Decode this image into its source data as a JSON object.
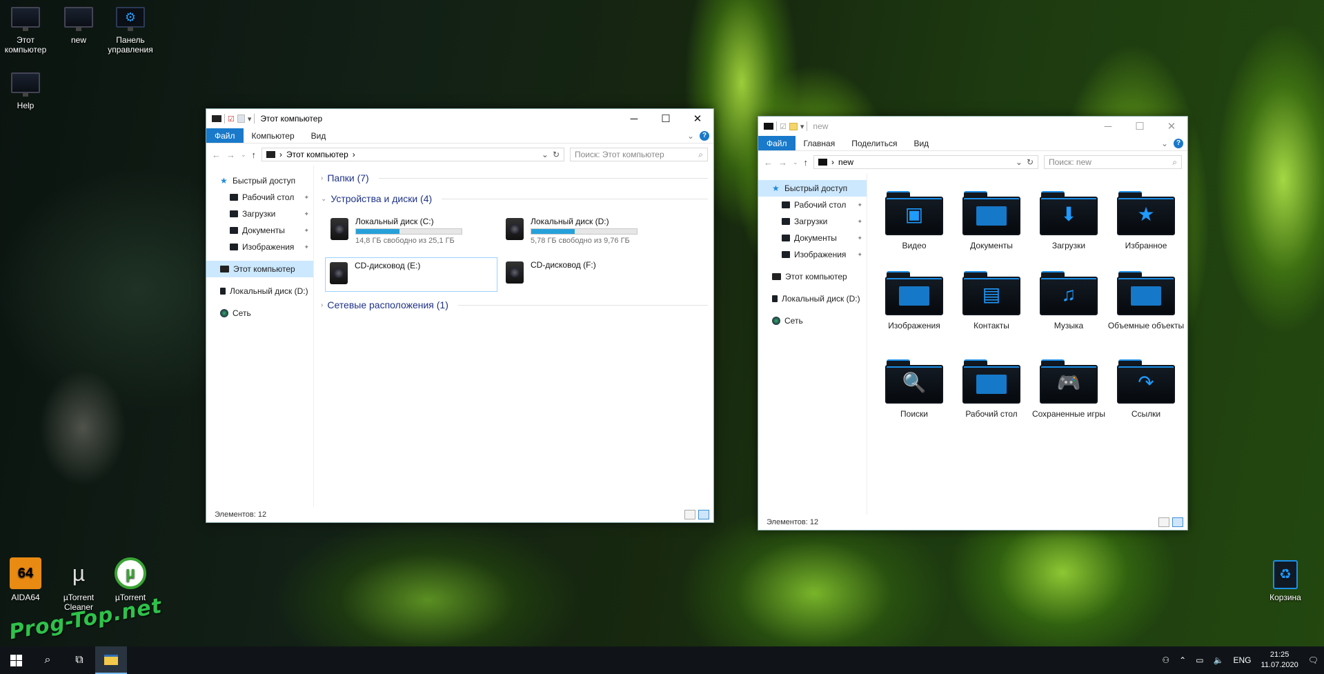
{
  "desktop": {
    "icons_top": [
      {
        "label": "Этот компьютер",
        "icon": "monitor-icon"
      },
      {
        "label": "new",
        "icon": "monitor-icon"
      },
      {
        "label": "Панель управления",
        "icon": "control-panel-icon"
      },
      {
        "label": "Help",
        "icon": "monitor-icon"
      }
    ],
    "icons_bottom": [
      {
        "label": "AIDA64",
        "icon": "aida64-icon"
      },
      {
        "label": "µTorrent Cleaner",
        "icon": "utorrent-cleaner-icon"
      },
      {
        "label": "µTorrent",
        "icon": "utorrent-icon"
      }
    ],
    "recycle_bin": "Корзина",
    "watermark": "Prog-Top.net"
  },
  "win1": {
    "title": "Этот компьютер",
    "tabs": {
      "file": "Файл",
      "computer": "Компьютер",
      "view": "Вид"
    },
    "address": "Этот компьютер",
    "search_placeholder": "Поиск: Этот компьютер",
    "nav": {
      "quick": "Быстрый доступ",
      "desktop": "Рабочий стол",
      "downloads": "Загрузки",
      "documents": "Документы",
      "images": "Изображения",
      "this_pc": "Этот компьютер",
      "local_d": "Локальный диск (D:)",
      "network": "Сеть"
    },
    "groups": {
      "folders": "Папки (7)",
      "devices": "Устройства и диски (4)",
      "network": "Сетевые расположения (1)"
    },
    "drives": [
      {
        "name": "Локальный диск (C:)",
        "free": "14,8 ГБ свободно из 25,1 ГБ",
        "used_fraction": 0.41
      },
      {
        "name": "Локальный диск (D:)",
        "free": "5,78 ГБ свободно из 9,76 ГБ",
        "used_fraction": 0.41
      },
      {
        "name": "CD-дисковод (E:)"
      },
      {
        "name": "CD-дисковод (F:)"
      }
    ],
    "status": "Элементов: 12"
  },
  "win2": {
    "title": "new",
    "tabs": {
      "file": "Файл",
      "home": "Главная",
      "share": "Поделиться",
      "view": "Вид"
    },
    "address": "new",
    "search_placeholder": "Поиск: new",
    "nav": {
      "quick": "Быстрый доступ",
      "desktop": "Рабочий стол",
      "downloads": "Загрузки",
      "documents": "Документы",
      "images": "Изображения",
      "this_pc": "Этот компьютер",
      "local_d": "Локальный диск (D:)",
      "network": "Сеть"
    },
    "folders": [
      {
        "label": "Видео",
        "glyph": "▣"
      },
      {
        "label": "Документы",
        "glyph": ""
      },
      {
        "label": "Загрузки",
        "glyph": "⬇"
      },
      {
        "label": "Избранное",
        "glyph": "★"
      },
      {
        "label": "Изображения",
        "glyph": ""
      },
      {
        "label": "Контакты",
        "glyph": "▤"
      },
      {
        "label": "Музыка",
        "glyph": "♫"
      },
      {
        "label": "Объемные объекты",
        "glyph": ""
      },
      {
        "label": "Поиски",
        "glyph": "🔍"
      },
      {
        "label": "Рабочий стол",
        "glyph": ""
      },
      {
        "label": "Сохраненные игры",
        "glyph": "🎮"
      },
      {
        "label": "Ссылки",
        "glyph": "↷"
      }
    ],
    "status": "Элементов: 12"
  },
  "taskbar": {
    "lang": "ENG",
    "time": "21:25",
    "date": "11.07.2020"
  }
}
